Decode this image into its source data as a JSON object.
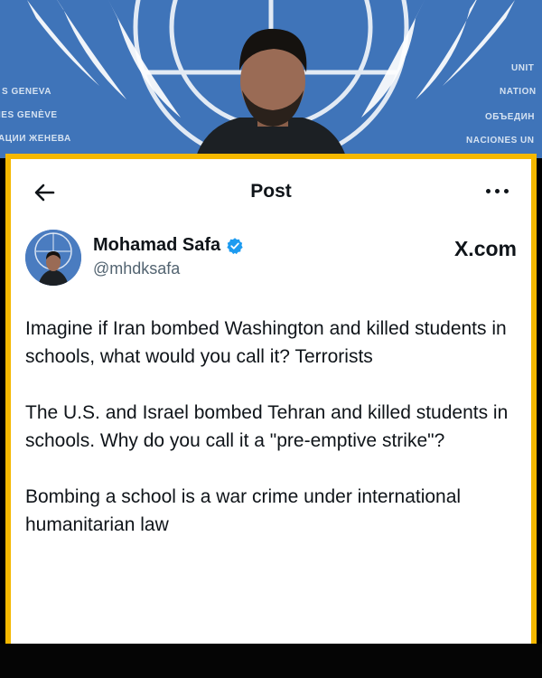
{
  "background_photo": {
    "wall_text_left": [
      "S GENEVA",
      "IES GENÈVE",
      "АЦИИ ЖЕНЕВА"
    ],
    "wall_text_right": [
      "UNIT",
      "NATION",
      "ОБЪЕДИН",
      "NACIONES UN"
    ]
  },
  "header": {
    "back_icon": "arrow-left-icon",
    "title": "Post",
    "more_icon": "more-horizontal-icon"
  },
  "author": {
    "display_name": "Mohamad Safa",
    "handle": "@mhdksafa",
    "verified": true,
    "verified_color": "#1d9bf0"
  },
  "source": "X.com",
  "post": {
    "paragraphs": [
      "Imagine if Iran bombed Washington and killed students in schools, what would you call it? Terrorists",
      "The U.S. and Israel bombed Tehran and killed students in schools. Why do you call it a \"pre-emptive strike\"?",
      "Bombing a school is a war crime under international humanitarian law"
    ]
  },
  "colors": {
    "frame": "#f5b800",
    "un_blue": "#3d73b8",
    "text": "#0f1419",
    "secondary_text": "#536471"
  }
}
